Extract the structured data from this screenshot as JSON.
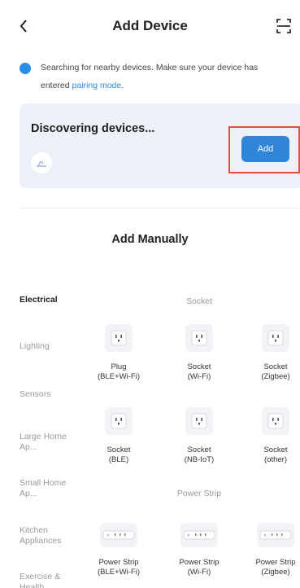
{
  "header": {
    "title": "Add Device"
  },
  "notice": {
    "text": "Searching for nearby devices. Make sure your device has entered ",
    "link": "pairing mode",
    "end": "."
  },
  "discover": {
    "title": "Discovering devices...",
    "add_label": "Add"
  },
  "manual": {
    "title": "Add Manually"
  },
  "categories": [
    "Electrical",
    "Lighting",
    "Sensors",
    "Large Home Ap...",
    "Small Home Ap...",
    "Kitchen Appliances",
    "Exercise & Health"
  ],
  "groups": [
    "Socket",
    "Power Strip"
  ],
  "devices": [
    "Plug\n(BLE+Wi-Fi)",
    "Socket\n(Wi-Fi)",
    "Socket\n(Zigbee)",
    "Socket\n(BLE)",
    "Socket\n(NB-IoT)",
    "Socket\n(other)",
    "Power Strip\n(BLE+Wi-Fi)",
    "Power Strip\n(Wi-Fi)",
    "Power Strip\n(Zigbee)"
  ],
  "colors": {
    "accent": "#2f86d8",
    "highlight": "#e05040",
    "card": "#eef2f8"
  }
}
